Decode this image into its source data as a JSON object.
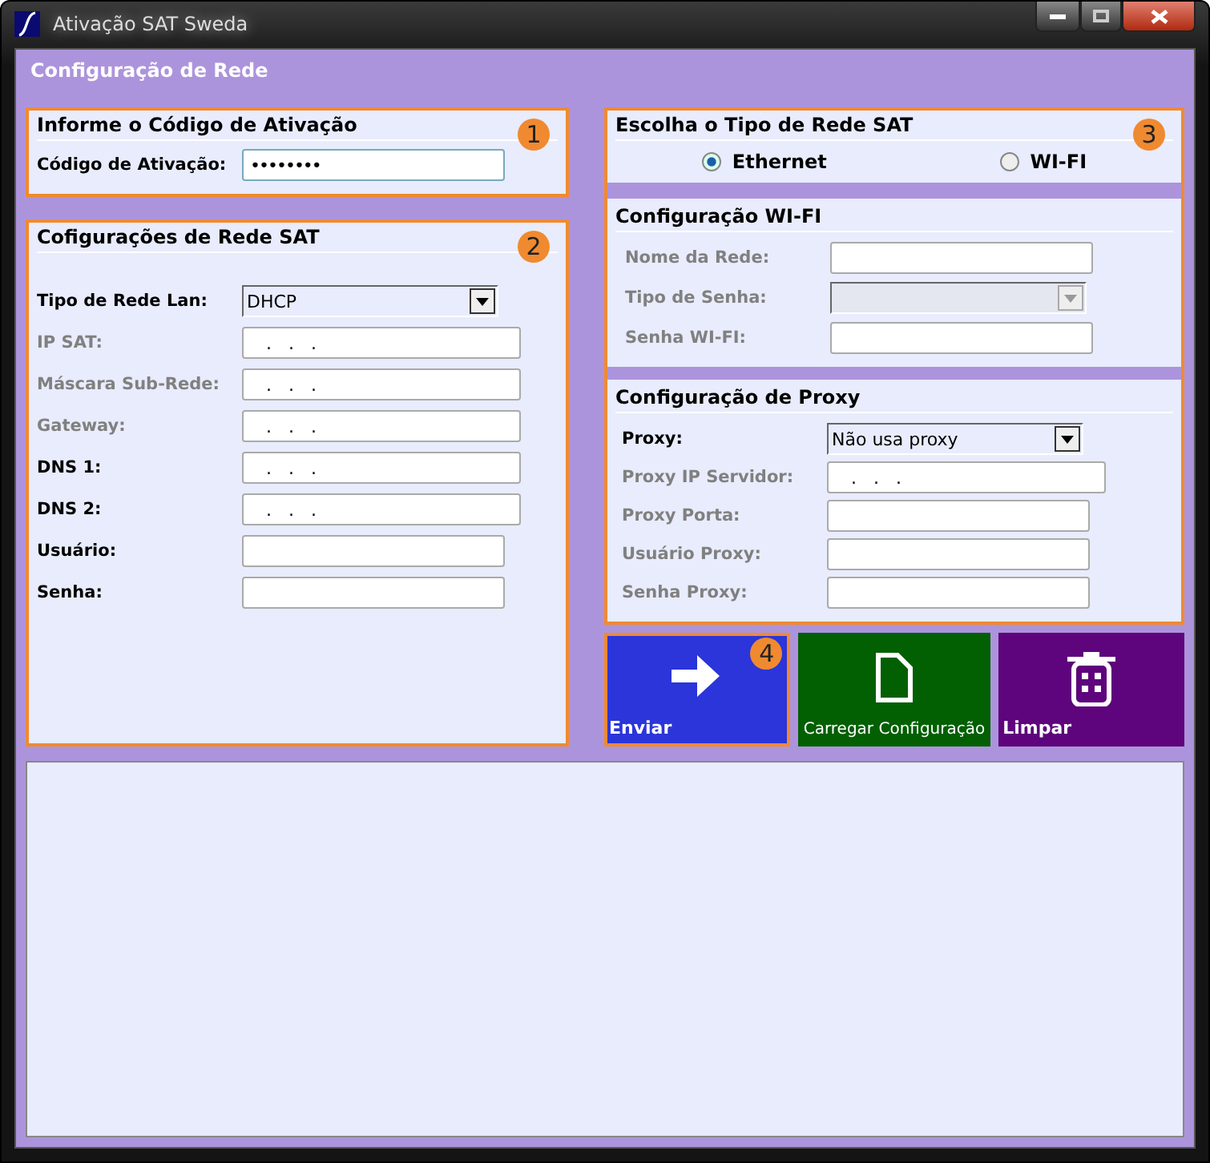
{
  "window": {
    "title": "Ativação SAT Sweda"
  },
  "header": "Configuração de Rede",
  "activation": {
    "title": "Informe o Código de Ativação",
    "badge": "1",
    "fields": [
      {
        "label": "Código de Ativação:",
        "kind": "password",
        "value": "••••••••",
        "disabled": false
      }
    ]
  },
  "network": {
    "title": "Cofigurações de Rede SAT",
    "badge": "2",
    "fields": [
      {
        "label": "Tipo de Rede Lan:",
        "kind": "select",
        "value": "DHCP",
        "disabled": false
      },
      {
        "label": "IP SAT:",
        "kind": "ip",
        "value": ".   .   .",
        "disabled": true
      },
      {
        "label": "Máscara Sub-Rede:",
        "kind": "ip",
        "value": ".   .   .",
        "disabled": true
      },
      {
        "label": "Gateway:",
        "kind": "ip",
        "value": ".   .   .",
        "disabled": true
      },
      {
        "label": "DNS 1:",
        "kind": "ip",
        "value": ".   .   .",
        "disabled": false
      },
      {
        "label": "DNS 2:",
        "kind": "ip",
        "value": ".   .   .",
        "disabled": false
      },
      {
        "label": "Usuário:",
        "kind": "text",
        "disabled": false
      },
      {
        "label": "Senha:",
        "kind": "text",
        "disabled": false
      }
    ]
  },
  "network_type": {
    "title": "Escolha o Tipo de Rede SAT",
    "badge": "3",
    "options": [
      {
        "label": "Ethernet",
        "selected": true
      },
      {
        "label": "WI-FI",
        "selected": false
      }
    ]
  },
  "wifi": {
    "title": "Configuração WI-FI",
    "fields": [
      {
        "label": "Nome da Rede:",
        "kind": "text",
        "disabled": true
      },
      {
        "label": "Tipo de Senha:",
        "kind": "select",
        "disabled": true
      },
      {
        "label": "Senha WI-FI:",
        "kind": "text",
        "disabled": true
      }
    ]
  },
  "proxy": {
    "title": "Configuração de Proxy",
    "fields": [
      {
        "label": "Proxy:",
        "kind": "select",
        "value": "Não usa proxy",
        "disabled": false
      },
      {
        "label": "Proxy IP Servidor:",
        "kind": "ip",
        "value": ".   .   .",
        "disabled": true
      },
      {
        "label": "Proxy Porta:",
        "kind": "text",
        "disabled": true
      },
      {
        "label": "Usuário Proxy:",
        "kind": "text",
        "disabled": true
      },
      {
        "label": "Senha Proxy:",
        "kind": "text",
        "disabled": true
      }
    ]
  },
  "buttons": [
    {
      "label": "Enviar",
      "kind": "send",
      "color": "#2b35d9",
      "badge": "4",
      "bold": true
    },
    {
      "label": "Carregar Configuração",
      "kind": "load",
      "color": "#025f02",
      "bold": false
    },
    {
      "label": "Limpar",
      "kind": "clear",
      "color": "#5e047c",
      "bold": true
    }
  ]
}
